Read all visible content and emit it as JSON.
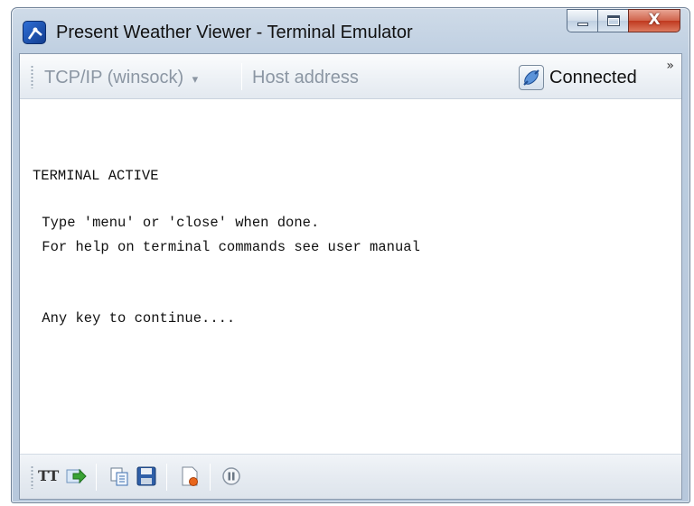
{
  "window": {
    "title": "Present Weather Viewer - Terminal Emulator",
    "close_glyph": "X"
  },
  "toolbar": {
    "connection_type": "TCP/IP (winsock)",
    "dropdown_arrow": "▾",
    "host_address": "Host address",
    "status_label": "Connected",
    "overflow_glyph": "»"
  },
  "terminal": {
    "lines": [
      "TERMINAL ACTIVE",
      " Type 'menu' or 'close' when done.",
      " For help on terminal commands see user manual",
      " Any key to continue...."
    ]
  },
  "bottom_toolbar": {
    "text_mode_label": "TT"
  },
  "colors": {
    "accent_green": "#3aa335",
    "accent_blue": "#2f6fd6",
    "record_orange": "#e8661c"
  },
  "icons": [
    "app-icon",
    "connection-plug-icon",
    "send-icon",
    "copy-icon",
    "save-icon",
    "log-file-icon",
    "pause-icon"
  ]
}
